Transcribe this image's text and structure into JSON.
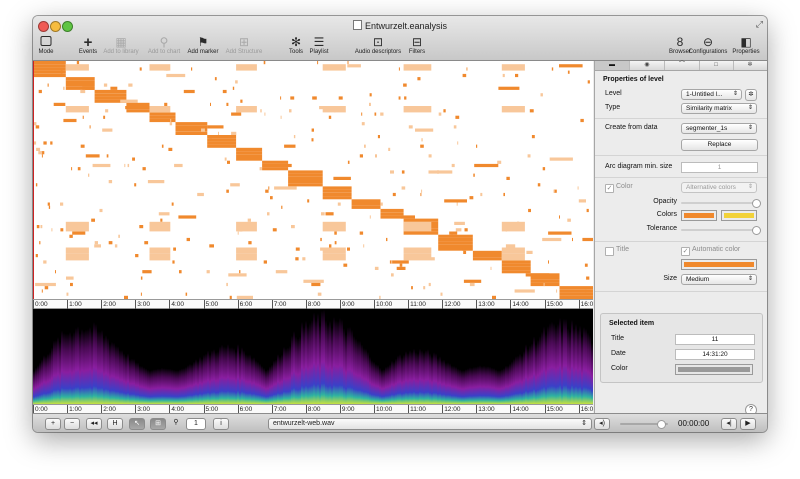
{
  "window": {
    "title": "Entwurzelt.eanalysis"
  },
  "toolbar": {
    "left": [
      {
        "label": "Mode",
        "icon": "mode-icon",
        "enabled": true
      },
      {
        "label": "Events",
        "icon": "plus-icon",
        "enabled": true
      },
      {
        "label": "Add to library",
        "icon": "library-icon",
        "enabled": false
      },
      {
        "label": "Add to chart",
        "icon": "chart-icon",
        "enabled": false
      },
      {
        "label": "Add marker",
        "icon": "marker-flag-icon",
        "enabled": true
      },
      {
        "label": "Add Structure",
        "icon": "structure-icon",
        "enabled": false
      },
      {
        "label": "Tools",
        "icon": "gear-icon",
        "enabled": true
      },
      {
        "label": "Playlist",
        "icon": "list-icon",
        "enabled": true
      },
      {
        "label": "Audio descriptors",
        "icon": "audio-descriptors-icon",
        "enabled": true
      },
      {
        "label": "Filters",
        "icon": "filters-icon",
        "enabled": true
      }
    ],
    "right": [
      {
        "label": "Browser",
        "icon": "browser-icon"
      },
      {
        "label": "Configurations",
        "icon": "configurations-icon"
      },
      {
        "label": "Properties",
        "icon": "properties-icon"
      }
    ]
  },
  "timeline": {
    "ticks": [
      "0:00",
      "1:00",
      "2:00",
      "3:00",
      "4:00",
      "5:00",
      "6:00",
      "7:00",
      "8:00",
      "9:00",
      "10:00",
      "11:00",
      "12:00",
      "13:00",
      "14:00",
      "15:00",
      "16:0"
    ]
  },
  "inspector": {
    "tabs": [
      "info-tab",
      "eye-tab",
      "shape-tab",
      "square-tab",
      "gear-tab"
    ],
    "heading": "Properties of level",
    "level_label": "Level",
    "level_value": "1-Untitled l...",
    "type_label": "Type",
    "type_value": "Similarity matrix",
    "create_label": "Create from data",
    "create_value": "segmenter_1s",
    "replace_button": "Replace",
    "arc_label": "Arc diagram min. size",
    "arc_value": "1",
    "color_label": "Color",
    "color_mode": "Alternative colors",
    "opacity_label": "Opacity",
    "opacity_value": 1.0,
    "colors_label": "Colors",
    "colors": [
      "#f0892d",
      "#f2d23a"
    ],
    "tolerance_label": "Tolerance",
    "tolerance_value": 1.0,
    "title_label": "Title",
    "auto_color_label": "Automatic color",
    "title_color": "#f0892d",
    "size_label": "Size",
    "size_value": "Medium",
    "selected": {
      "heading": "Selected item",
      "title_label": "Title",
      "title_value": "11",
      "date_label": "Date",
      "date_value": "14:31:20",
      "color_label": "Color",
      "color_value": "#999999"
    },
    "help": "?"
  },
  "bottom": {
    "plus": "+",
    "minus": "−",
    "rewind": "◂◂",
    "mark": "H",
    "page_field": "1",
    "info": "i",
    "file": "entwurzelt-web.wav",
    "volume_icon": "speaker-icon",
    "volume_value": 0.85,
    "time": "00:00:00",
    "prev": "◂|",
    "play": "▶"
  },
  "colors": {
    "orange": "#f0892d",
    "light_orange": "#f8c79a",
    "accent_red": "#cc2222"
  },
  "matrix_data": {
    "time_range_sec": [
      0,
      968
    ],
    "rows": 74,
    "diagonal_blocks_sec": [
      [
        0,
        55
      ],
      [
        55,
        105
      ],
      [
        105,
        160
      ],
      [
        160,
        200
      ],
      [
        200,
        245
      ],
      [
        245,
        300
      ],
      [
        300,
        350
      ],
      [
        350,
        395
      ],
      [
        395,
        440
      ],
      [
        440,
        500
      ],
      [
        500,
        550
      ],
      [
        550,
        600
      ],
      [
        600,
        640
      ],
      [
        640,
        700
      ],
      [
        700,
        760
      ],
      [
        760,
        810
      ],
      [
        810,
        860
      ],
      [
        860,
        910
      ],
      [
        910,
        968
      ]
    ]
  }
}
